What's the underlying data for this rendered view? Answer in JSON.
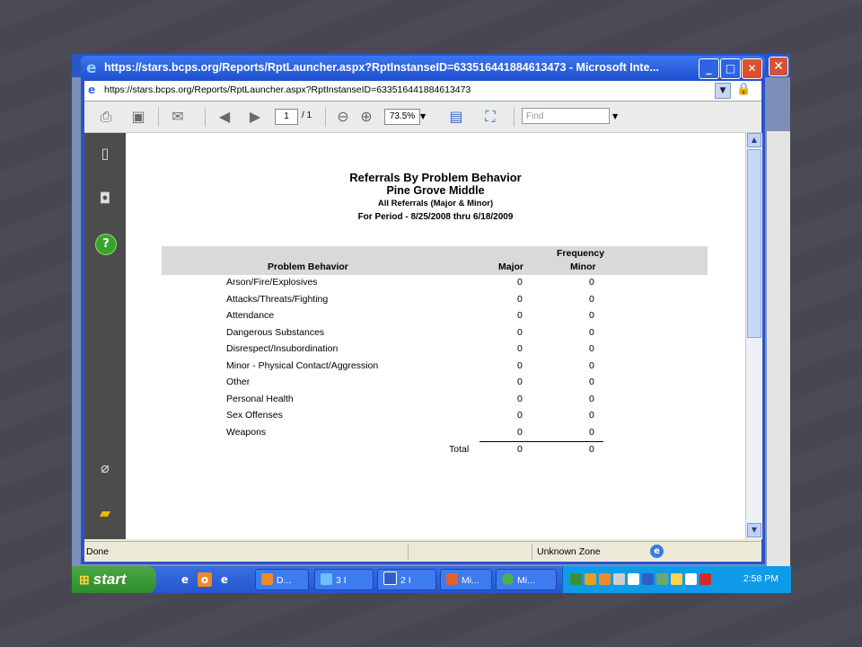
{
  "window": {
    "title": "https://stars.bcps.org/Reports/RptLauncher.aspx?RptInstanseID=633516441884613473 - Microsoft Inte...",
    "address": "https://stars.bcps.org/Reports/RptLauncher.aspx?RptInstanseID=633516441884613473"
  },
  "toolbar": {
    "page_current": "1",
    "page_of": "/ 1",
    "zoom": "73.5%",
    "find_placeholder": "Find"
  },
  "report": {
    "title": "Referrals By Problem Behavior",
    "school": "Pine Grove Middle",
    "subtitle": "All Referrals (Major & Minor)",
    "period": "For Period - 8/25/2008 thru 6/18/2009",
    "header_frequency": "Frequency",
    "header_behavior": "Problem Behavior",
    "header_major": "Major",
    "header_minor": "Minor",
    "rows": [
      {
        "label": "Arson/Fire/Explosives",
        "major": "0",
        "minor": "0"
      },
      {
        "label": "Attacks/Threats/Fighting",
        "major": "0",
        "minor": "0"
      },
      {
        "label": "Attendance",
        "major": "0",
        "minor": "0"
      },
      {
        "label": "Dangerous Substances",
        "major": "0",
        "minor": "0"
      },
      {
        "label": "Disrespect/Insubordination",
        "major": "0",
        "minor": "0"
      },
      {
        "label": "Minor - Physical Contact/Aggression",
        "major": "0",
        "minor": "0"
      },
      {
        "label": "Other",
        "major": "0",
        "minor": "0"
      },
      {
        "label": "Personal Health",
        "major": "0",
        "minor": "0"
      },
      {
        "label": "Sex Offenses",
        "major": "0",
        "minor": "0"
      },
      {
        "label": "Weapons",
        "major": "0",
        "minor": "0"
      }
    ],
    "total_label": "Total",
    "total_major": "0",
    "total_minor": "0"
  },
  "status": {
    "left": "Done",
    "zone": "Unknown Zone"
  },
  "taskbar": {
    "start_label": "start",
    "tasks": [
      "D...",
      "3 I",
      "2 I",
      "Mi...",
      "Mi..."
    ],
    "clock": "2:58 PM"
  },
  "icons": {
    "page_list": "pages-icon",
    "search": "binoculars-icon",
    "help": "help-icon",
    "attach": "paperclip-icon",
    "comment": "comments-icon"
  },
  "colors": {
    "titlebar": "#2b56c8",
    "close": "#d9512f",
    "start": "#3a9a35",
    "tray": "#0f9be8"
  }
}
